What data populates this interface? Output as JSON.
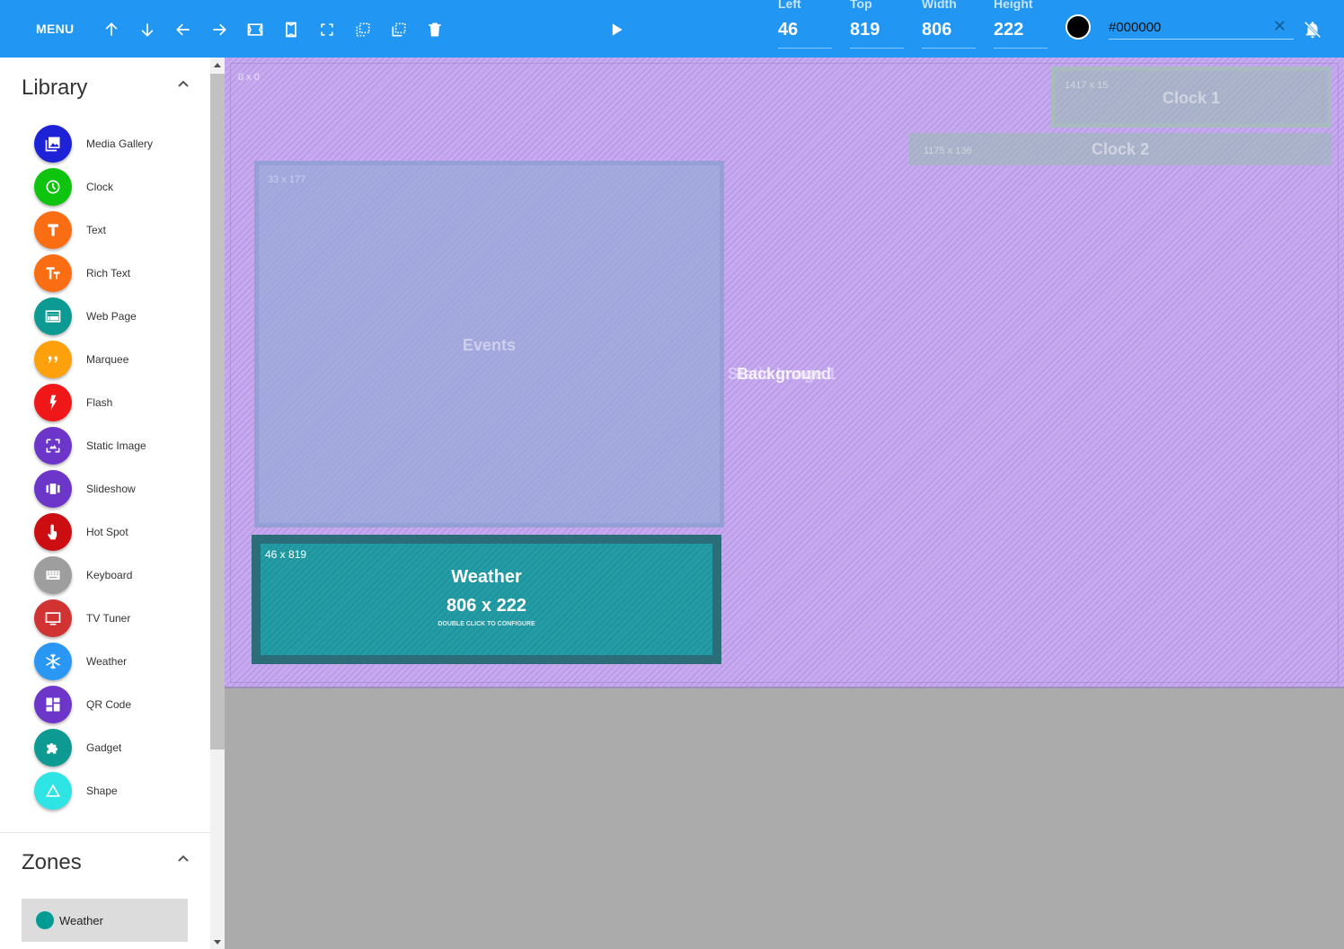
{
  "toolbar": {
    "menu_label": "MENU",
    "icons": [
      "arrow-up-icon",
      "arrow-down-icon",
      "arrow-left-icon",
      "arrow-right-icon",
      "fit-width-icon",
      "fit-height-icon",
      "fullscreen-icon",
      "bring-front-icon",
      "send-back-icon",
      "delete-icon",
      "play-icon"
    ],
    "fields": {
      "left": {
        "label": "Left",
        "value": "46"
      },
      "top": {
        "label": "Top",
        "value": "819"
      },
      "width": {
        "label": "Width",
        "value": "806"
      },
      "height": {
        "label": "Height",
        "value": "222"
      }
    },
    "color_value": "#000000",
    "clear_symbol": "✕"
  },
  "library": {
    "title": "Library",
    "items": [
      {
        "label": "Media Gallery",
        "color": "#1e22d6",
        "icon": "image-icon"
      },
      {
        "label": "Clock",
        "color": "#0fc40f",
        "icon": "clock-icon"
      },
      {
        "label": "Text",
        "color": "#fb6d12",
        "icon": "text-icon"
      },
      {
        "label": "Rich Text",
        "color": "#fb6d12",
        "icon": "rich-text-icon"
      },
      {
        "label": "Web Page",
        "color": "#0d9a93",
        "icon": "web-page-icon"
      },
      {
        "label": "Marquee",
        "color": "#fca10c",
        "icon": "quote-icon"
      },
      {
        "label": "Flash",
        "color": "#ef1717",
        "icon": "flash-icon"
      },
      {
        "label": "Static Image",
        "color": "#6c37c8",
        "icon": "static-image-icon"
      },
      {
        "label": "Slideshow",
        "color": "#6c37c8",
        "icon": "slideshow-icon"
      },
      {
        "label": "Hot Spot",
        "color": "#cc0e12",
        "icon": "touch-icon"
      },
      {
        "label": "Keyboard",
        "color": "#9e9e9e",
        "icon": "keyboard-icon"
      },
      {
        "label": "TV Tuner",
        "color": "#d13232",
        "icon": "tv-icon"
      },
      {
        "label": "Weather",
        "color": "#2b97f4",
        "icon": "snowflake-icon"
      },
      {
        "label": "QR Code",
        "color": "#6c37c8",
        "icon": "qr-code-icon"
      },
      {
        "label": "Gadget",
        "color": "#0d9a93",
        "icon": "puzzle-icon"
      },
      {
        "label": "Shape",
        "color": "#2ee4e4",
        "icon": "triangle-icon"
      }
    ]
  },
  "zones": {
    "title": "Zones",
    "items": [
      {
        "label": "Weather",
        "color": "#009b94"
      }
    ]
  },
  "canvas": {
    "origin": "0 x 0",
    "background_label": "Background",
    "background_label_overlap": "Static Image 1",
    "events": {
      "title": "Events",
      "coord": "33 x 177"
    },
    "clock1": {
      "title": "Clock 1",
      "coord": "1417 x 15"
    },
    "clock2": {
      "title": "Clock 2",
      "coord": "1175 x 136"
    },
    "weather": {
      "title": "Weather",
      "coord": "46 x 819",
      "size": "806 x 222",
      "hint": "DOUBLE CLICK TO CONFIGURE"
    }
  }
}
